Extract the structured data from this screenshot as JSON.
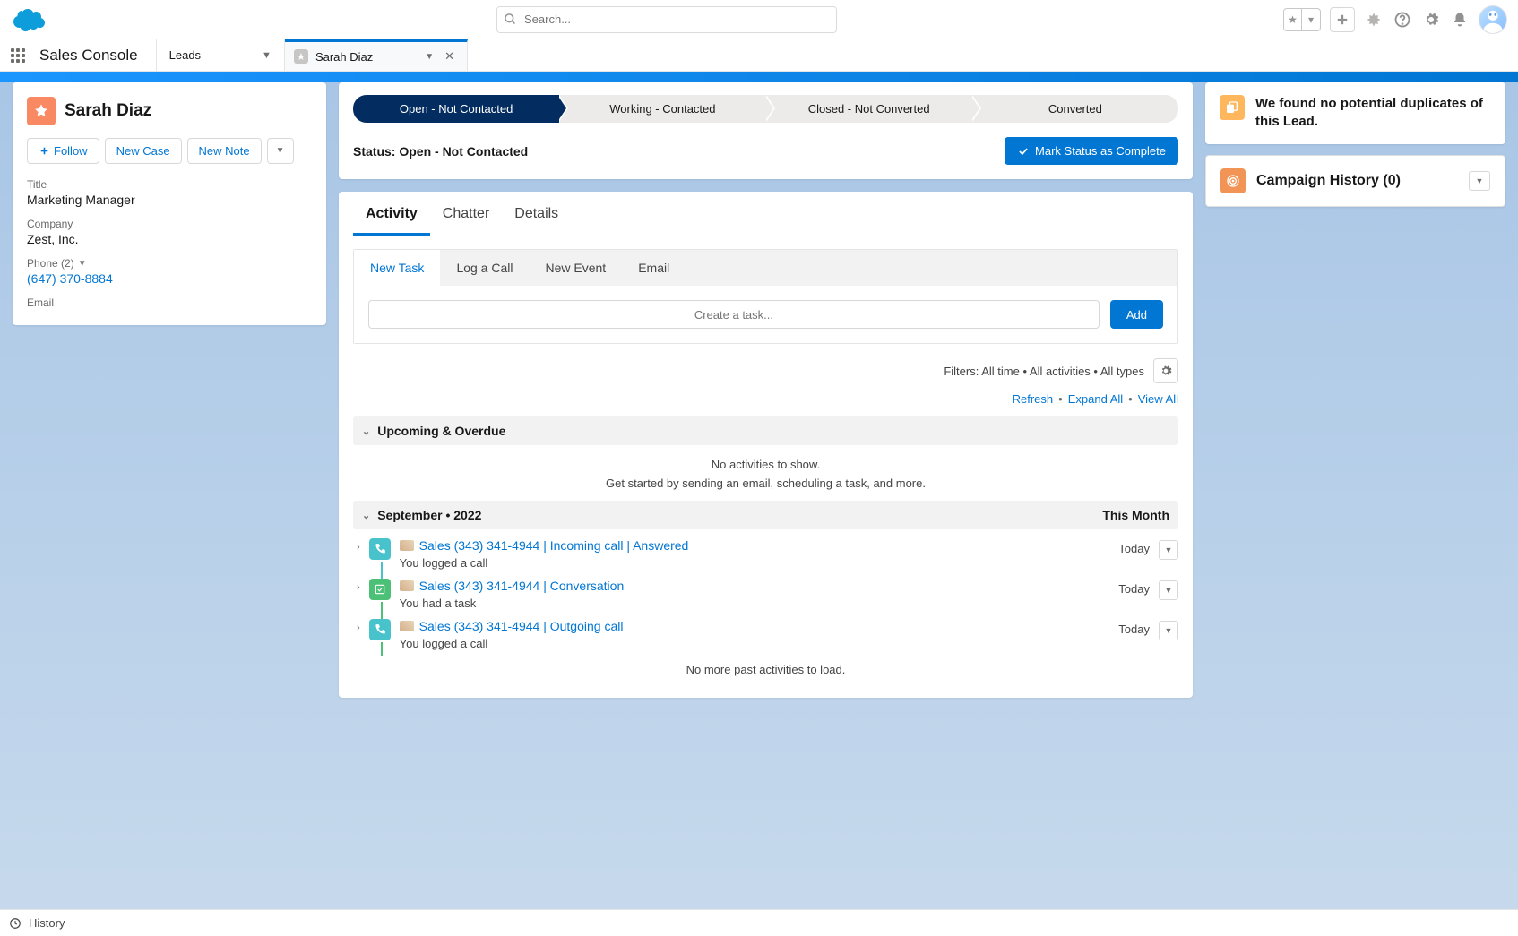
{
  "global_header": {
    "search_placeholder": "Search..."
  },
  "app_nav": {
    "app_name": "Sales Console",
    "primary_tab": "Leads",
    "subtab_label": "Sarah Diaz"
  },
  "lead": {
    "name": "Sarah Diaz",
    "actions": {
      "follow": "Follow",
      "new_case": "New Case",
      "new_note": "New Note"
    },
    "fields": {
      "title_label": "Title",
      "title_value": "Marketing Manager",
      "company_label": "Company",
      "company_value": "Zest, Inc.",
      "phone_label": "Phone (2)",
      "phone_value": "(647) 370-8884",
      "email_label": "Email"
    }
  },
  "path": {
    "stages": [
      "Open - Not Contacted",
      "Working - Contacted",
      "Closed - Not Converted",
      "Converted"
    ],
    "status_label": "Status:",
    "status_value": "Open - Not Contacted",
    "mark_complete": "Mark Status as Complete"
  },
  "activity": {
    "main_tabs": {
      "activity": "Activity",
      "chatter": "Chatter",
      "details": "Details"
    },
    "composer_tabs": {
      "new_task": "New Task",
      "log_call": "Log a Call",
      "new_event": "New Event",
      "email": "Email"
    },
    "composer_placeholder": "Create a task...",
    "add_button": "Add",
    "filters_text": "Filters: All time • All activities • All types",
    "links": {
      "refresh": "Refresh",
      "expand_all": "Expand All",
      "view_all": "View All"
    },
    "upcoming_header": "Upcoming & Overdue",
    "empty_line1": "No activities to show.",
    "empty_line2": "Get started by sending an email, scheduling a task, and more.",
    "month_header": "September • 2022",
    "month_right": "This Month",
    "items": [
      {
        "title": "Sales (343) 341-4944 | Incoming call | Answered",
        "sub": "You logged a call",
        "date": "Today",
        "icon": "call"
      },
      {
        "title": "Sales (343) 341-4944 | Conversation",
        "sub": "You had a task",
        "date": "Today",
        "icon": "task"
      },
      {
        "title": "Sales (343) 341-4944 | Outgoing call",
        "sub": "You logged a call",
        "date": "Today",
        "icon": "call"
      }
    ],
    "footer_msg": "No more past activities to load."
  },
  "right": {
    "duplicates_text": "We found no potential duplicates of this Lead.",
    "campaign_history": "Campaign History (0)"
  },
  "footer": {
    "history": "History"
  }
}
